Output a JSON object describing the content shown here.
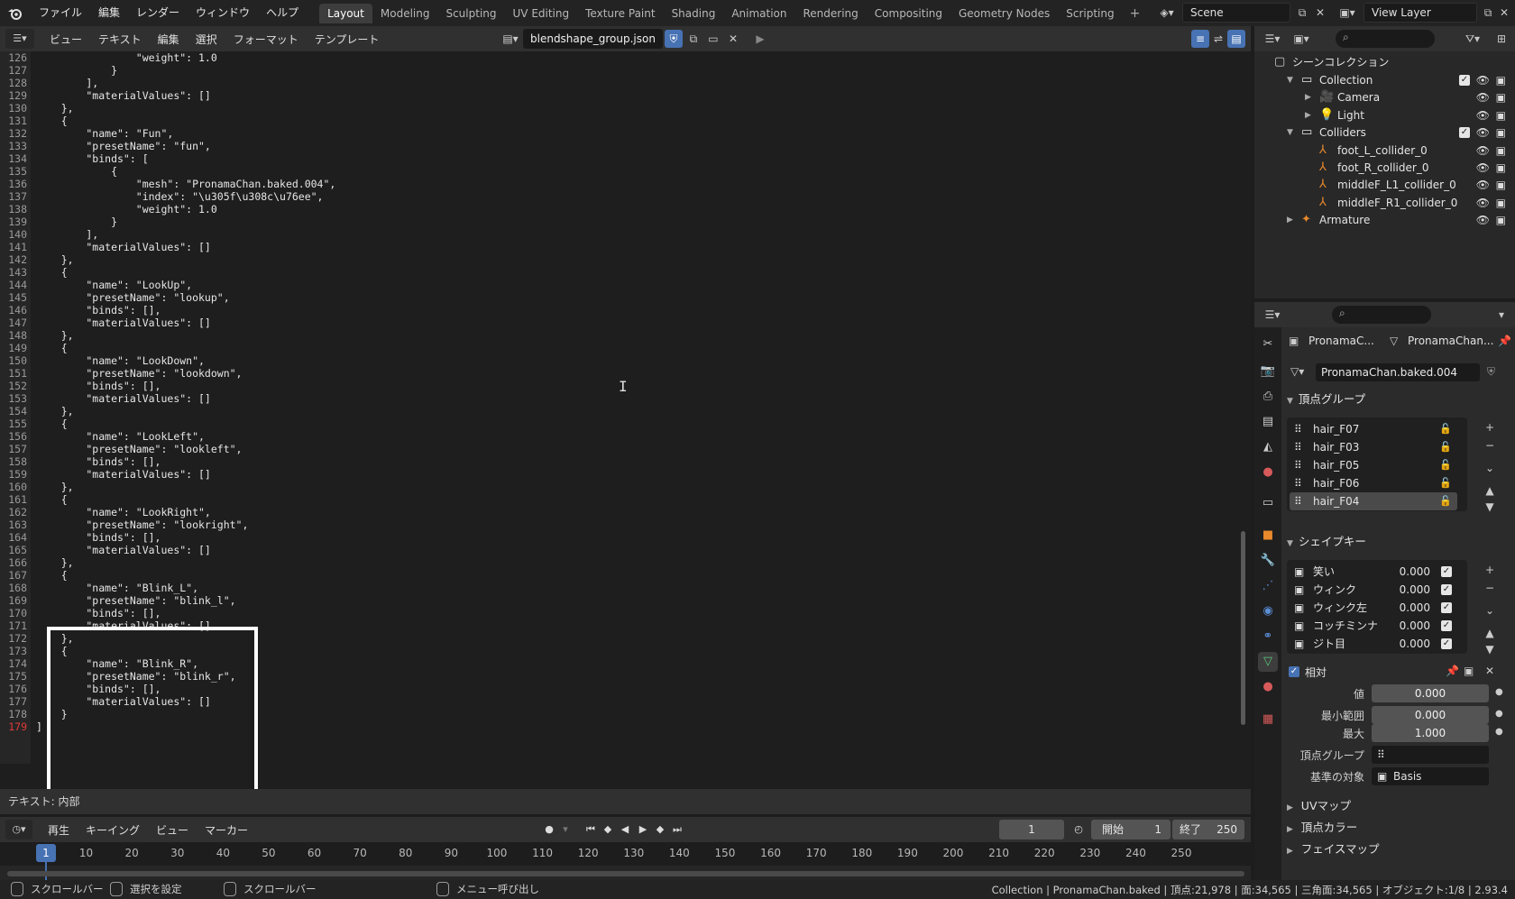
{
  "topbar": {
    "menus": [
      "ファイル",
      "編集",
      "レンダー",
      "ウィンドウ",
      "ヘルプ"
    ],
    "workspaces": [
      "Layout",
      "Modeling",
      "Sculpting",
      "UV Editing",
      "Texture Paint",
      "Shading",
      "Animation",
      "Rendering",
      "Compositing",
      "Geometry Nodes",
      "Scripting"
    ],
    "active_workspace": "Layout",
    "scene": "Scene",
    "view_layer": "View Layer"
  },
  "editor": {
    "menus": [
      "ビュー",
      "テキスト",
      "編集",
      "選択",
      "フォーマット",
      "テンプレート"
    ],
    "filename": "blendshape_group.json",
    "footer": "テキスト: 内部",
    "current_line": 179,
    "lines": [
      {
        "n": 126,
        "t": "                \"weight\": 1.0"
      },
      {
        "n": 127,
        "t": "            }"
      },
      {
        "n": 128,
        "t": "        ],"
      },
      {
        "n": 129,
        "t": "        \"materialValues\": []"
      },
      {
        "n": 130,
        "t": "    },"
      },
      {
        "n": 131,
        "t": "    {"
      },
      {
        "n": 132,
        "t": "        \"name\": \"Fun\","
      },
      {
        "n": 133,
        "t": "        \"presetName\": \"fun\","
      },
      {
        "n": 134,
        "t": "        \"binds\": ["
      },
      {
        "n": 135,
        "t": "            {"
      },
      {
        "n": 136,
        "t": "                \"mesh\": \"PronamaChan.baked.004\","
      },
      {
        "n": 137,
        "t": "                \"index\": \"\\u305f\\u308c\\u76ee\","
      },
      {
        "n": 138,
        "t": "                \"weight\": 1.0"
      },
      {
        "n": 139,
        "t": "            }"
      },
      {
        "n": 140,
        "t": "        ],"
      },
      {
        "n": 141,
        "t": "        \"materialValues\": []"
      },
      {
        "n": 142,
        "t": "    },"
      },
      {
        "n": 143,
        "t": "    {"
      },
      {
        "n": 144,
        "t": "        \"name\": \"LookUp\","
      },
      {
        "n": 145,
        "t": "        \"presetName\": \"lookup\","
      },
      {
        "n": 146,
        "t": "        \"binds\": [],"
      },
      {
        "n": 147,
        "t": "        \"materialValues\": []"
      },
      {
        "n": 148,
        "t": "    },"
      },
      {
        "n": 149,
        "t": "    {"
      },
      {
        "n": 150,
        "t": "        \"name\": \"LookDown\","
      },
      {
        "n": 151,
        "t": "        \"presetName\": \"lookdown\","
      },
      {
        "n": 152,
        "t": "        \"binds\": [],"
      },
      {
        "n": 153,
        "t": "        \"materialValues\": []"
      },
      {
        "n": 154,
        "t": "    },"
      },
      {
        "n": 155,
        "t": "    {"
      },
      {
        "n": 156,
        "t": "        \"name\": \"LookLeft\","
      },
      {
        "n": 157,
        "t": "        \"presetName\": \"lookleft\","
      },
      {
        "n": 158,
        "t": "        \"binds\": [],"
      },
      {
        "n": 159,
        "t": "        \"materialValues\": []"
      },
      {
        "n": 160,
        "t": "    },"
      },
      {
        "n": 161,
        "t": "    {"
      },
      {
        "n": 162,
        "t": "        \"name\": \"LookRight\","
      },
      {
        "n": 163,
        "t": "        \"presetName\": \"lookright\","
      },
      {
        "n": 164,
        "t": "        \"binds\": [],"
      },
      {
        "n": 165,
        "t": "        \"materialValues\": []"
      },
      {
        "n": 166,
        "t": "    },"
      },
      {
        "n": 167,
        "t": "    {"
      },
      {
        "n": 168,
        "t": "        \"name\": \"Blink_L\","
      },
      {
        "n": 169,
        "t": "        \"presetName\": \"blink_l\","
      },
      {
        "n": 170,
        "t": "        \"binds\": [],"
      },
      {
        "n": 171,
        "t": "        \"materialValues\": []"
      },
      {
        "n": 172,
        "t": "    },"
      },
      {
        "n": 173,
        "t": "    {"
      },
      {
        "n": 174,
        "t": "        \"name\": \"Blink_R\","
      },
      {
        "n": 175,
        "t": "        \"presetName\": \"blink_r\","
      },
      {
        "n": 176,
        "t": "        \"binds\": [],"
      },
      {
        "n": 177,
        "t": "        \"materialValues\": []"
      },
      {
        "n": 178,
        "t": "    }"
      },
      {
        "n": 179,
        "t": "]"
      }
    ]
  },
  "timeline": {
    "menus": [
      "再生",
      "キーイング",
      "ビュー",
      "マーカー"
    ],
    "current_frame": "1",
    "start_label": "開始",
    "start": "1",
    "end_label": "終了",
    "end": "250",
    "ticks": [
      10,
      20,
      30,
      40,
      50,
      60,
      70,
      80,
      90,
      100,
      110,
      120,
      130,
      140,
      150,
      160,
      170,
      180,
      190,
      200,
      210,
      220,
      230,
      240,
      250
    ]
  },
  "statusbar": {
    "left": [
      "スクロールバー",
      "選択を設定",
      "スクロールバー",
      "メニュー呼び出し"
    ],
    "right": "Collection | PronamaChan.baked | 頂点:21,978 | 面:34,565 | 三角面:34,565 | オブジェクト:1/8 | 2.93.4"
  },
  "outliner": {
    "root": "シーンコレクション",
    "rows": [
      {
        "label": "Collection",
        "indent": 1,
        "icon": "collection-icon",
        "expanded": true,
        "check": true
      },
      {
        "label": "Camera",
        "indent": 2,
        "icon": "camera-icon",
        "expanded": false,
        "check": false
      },
      {
        "label": "Light",
        "indent": 2,
        "icon": "light-icon",
        "expanded": false,
        "check": false
      },
      {
        "label": "Colliders",
        "indent": 1,
        "icon": "collection-icon",
        "expanded": true,
        "check": true
      },
      {
        "label": "foot_L_collider_0",
        "indent": 2,
        "icon": "empty-icon",
        "expanded": null,
        "check": false
      },
      {
        "label": "foot_R_collider_0",
        "indent": 2,
        "icon": "empty-icon",
        "expanded": null,
        "check": false
      },
      {
        "label": "middleF_L1_collider_0",
        "indent": 2,
        "icon": "empty-icon",
        "expanded": null,
        "check": false
      },
      {
        "label": "middleF_R1_collider_0",
        "indent": 2,
        "icon": "empty-icon",
        "expanded": null,
        "check": false
      },
      {
        "label": "Armature",
        "indent": 1,
        "icon": "armature-icon",
        "expanded": false,
        "check": false
      }
    ]
  },
  "properties": {
    "breadcrumb_object": "PronamaC...",
    "breadcrumb_mesh": "PronamaChan...",
    "mesh_name": "PronamaChan.baked.004",
    "vertex_groups_title": "頂点グループ",
    "vertex_groups": [
      "hair_F07",
      "hair_F03",
      "hair_F05",
      "hair_F06",
      "hair_F04"
    ],
    "vertex_groups_selected": 4,
    "shape_keys_title": "シェイプキー",
    "shape_keys": [
      {
        "name": "笑い",
        "value": "0.000"
      },
      {
        "name": "ウィンク",
        "value": "0.000"
      },
      {
        "name": "ウィンク左",
        "value": "0.000"
      },
      {
        "name": "コッチミンナ",
        "value": "0.000"
      },
      {
        "name": "ジト目",
        "value": "0.000"
      }
    ],
    "relative_label": "相対",
    "value_label": "値",
    "value": "0.000",
    "min_label": "最小範囲",
    "min": "0.000",
    "max_label": "最大",
    "max": "1.000",
    "vg_field_label": "頂点グループ",
    "relative_to_label": "基準の対象",
    "relative_to": "Basis",
    "collapsed_panels": [
      "UVマップ",
      "頂点カラー",
      "フェイスマップ"
    ]
  },
  "colors": {
    "accent": "#4772b3",
    "highlight_box": "#ffffff",
    "current_line": "#e03a3a"
  }
}
